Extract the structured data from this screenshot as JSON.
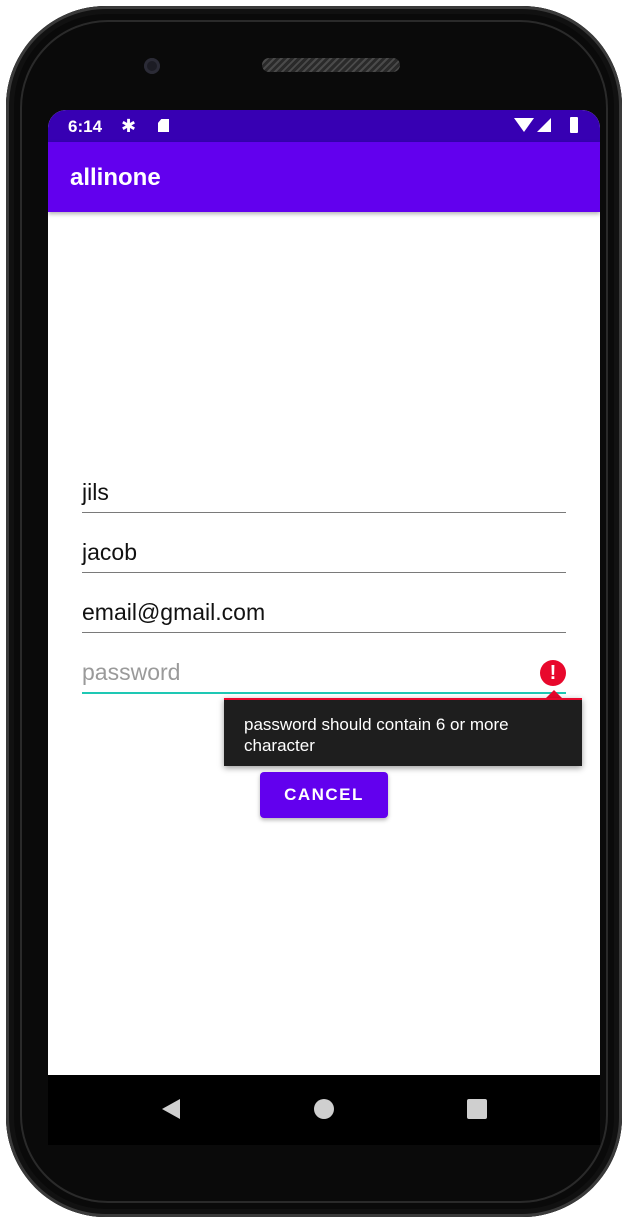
{
  "status_bar": {
    "time": "6:14",
    "icons": [
      "settings-icon",
      "sd-card-icon",
      "wifi-icon",
      "signal-icon",
      "battery-icon"
    ]
  },
  "app_bar": {
    "title": "allinone"
  },
  "form": {
    "first_name_value": "jils",
    "last_name_value": "jacob",
    "email_value": "email@gmail.com",
    "password_placeholder": "password",
    "password_error": "password should contain 6 or more character"
  },
  "buttons": {
    "cancel_label": "CANCEL"
  },
  "nav_bar": {
    "icons": [
      "back-icon",
      "home-icon",
      "recents-icon"
    ]
  },
  "colors": {
    "status_bar": "#3700b3",
    "primary": "#6200ee",
    "focus_underline": "#1ec8b4",
    "error": "#e8082c"
  }
}
